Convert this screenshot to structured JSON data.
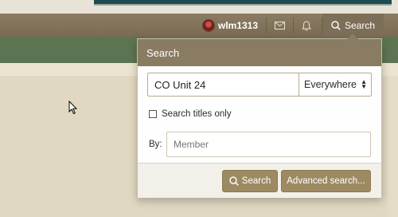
{
  "nav": {
    "username": "wlm1313",
    "search_label": "Search",
    "icons": [
      "avatar",
      "envelope-icon",
      "bell-icon",
      "search-icon"
    ]
  },
  "search_menu": {
    "title": "Search",
    "keywords_value": "CO Unit 24",
    "scope_selected": "Everywhere",
    "titles_only_label": "Search titles only",
    "titles_only_checked": false,
    "by_label": "By:",
    "member_placeholder": "Member",
    "search_button": "Search",
    "advanced_button": "Advanced search..."
  },
  "colors": {
    "navbar": "#7d6e58",
    "subnav": "#5d7452",
    "menu_header": "#8a7b63",
    "button": "#9d8a62",
    "page_bg": "#e4dcc5"
  }
}
